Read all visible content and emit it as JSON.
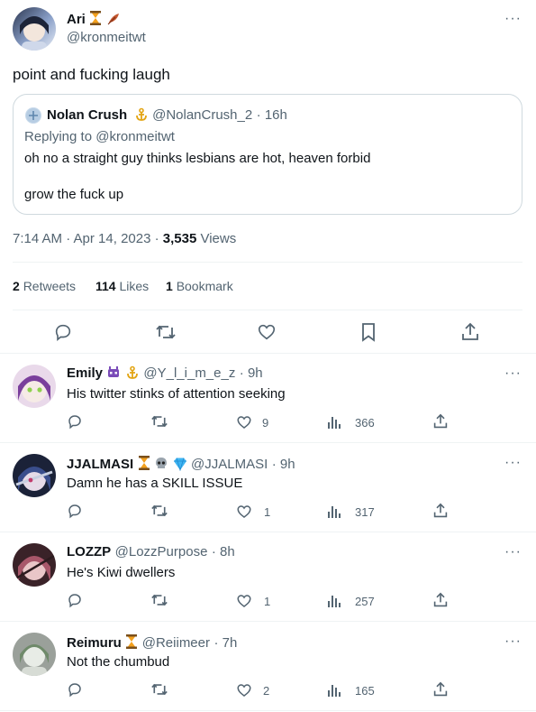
{
  "tweet": {
    "author_name": "Ari",
    "author_handle": "@kronmeitwt",
    "text": "point and fucking laugh",
    "quote": {
      "author_name": "Nolan Crush",
      "author_handle": "@NolanCrush_2",
      "time": "· 16h",
      "replying_to": "Replying to @kronmeitwt",
      "line1": "oh no a straight guy thinks lesbians are hot, heaven forbid",
      "line2": "grow the fuck up"
    },
    "timestamp": "7:14 AM · Apr 14, 2023 · ",
    "views_count": "3,535",
    "views_label": " Views",
    "stats": {
      "retweets_count": "2",
      "retweets_label": "Retweets",
      "likes_count": "114",
      "likes_label": "Likes",
      "bookmarks_count": "1",
      "bookmarks_label": "Bookmark"
    }
  },
  "replies": [
    {
      "name": "Emily",
      "handle": "@Y_l_i_m_e_z",
      "time": "· 9h",
      "text": "His twitter stinks of attention seeking",
      "likes": "9",
      "views": "366"
    },
    {
      "name": "JJALMASI",
      "handle": "@JJALMASI",
      "time": "· 9h",
      "text": "Damn he has a SKILL ISSUE",
      "likes": "1",
      "views": "317"
    },
    {
      "name": "LOZZP",
      "handle": "@LozzPurpose",
      "time": "· 8h",
      "text": "He's Kiwi dwellers",
      "likes": "1",
      "views": "257"
    },
    {
      "name": "Reimuru",
      "handle": "@Reiimeer",
      "time": "· 7h",
      "text": "Not the chumbud",
      "likes": "2",
      "views": "165"
    }
  ],
  "icons": {
    "more": "more-icon",
    "reply": "reply-icon",
    "retweet": "retweet-icon",
    "like": "heart-icon",
    "bookmark": "bookmark-icon",
    "share": "share-icon",
    "views": "views-icon"
  },
  "colors": {
    "text": "#0f1419",
    "muted": "#536471",
    "border": "#cfd9de",
    "divider": "#eff3f4",
    "hourglass": "#f4a11e",
    "gold_badge": "#e3a514"
  }
}
